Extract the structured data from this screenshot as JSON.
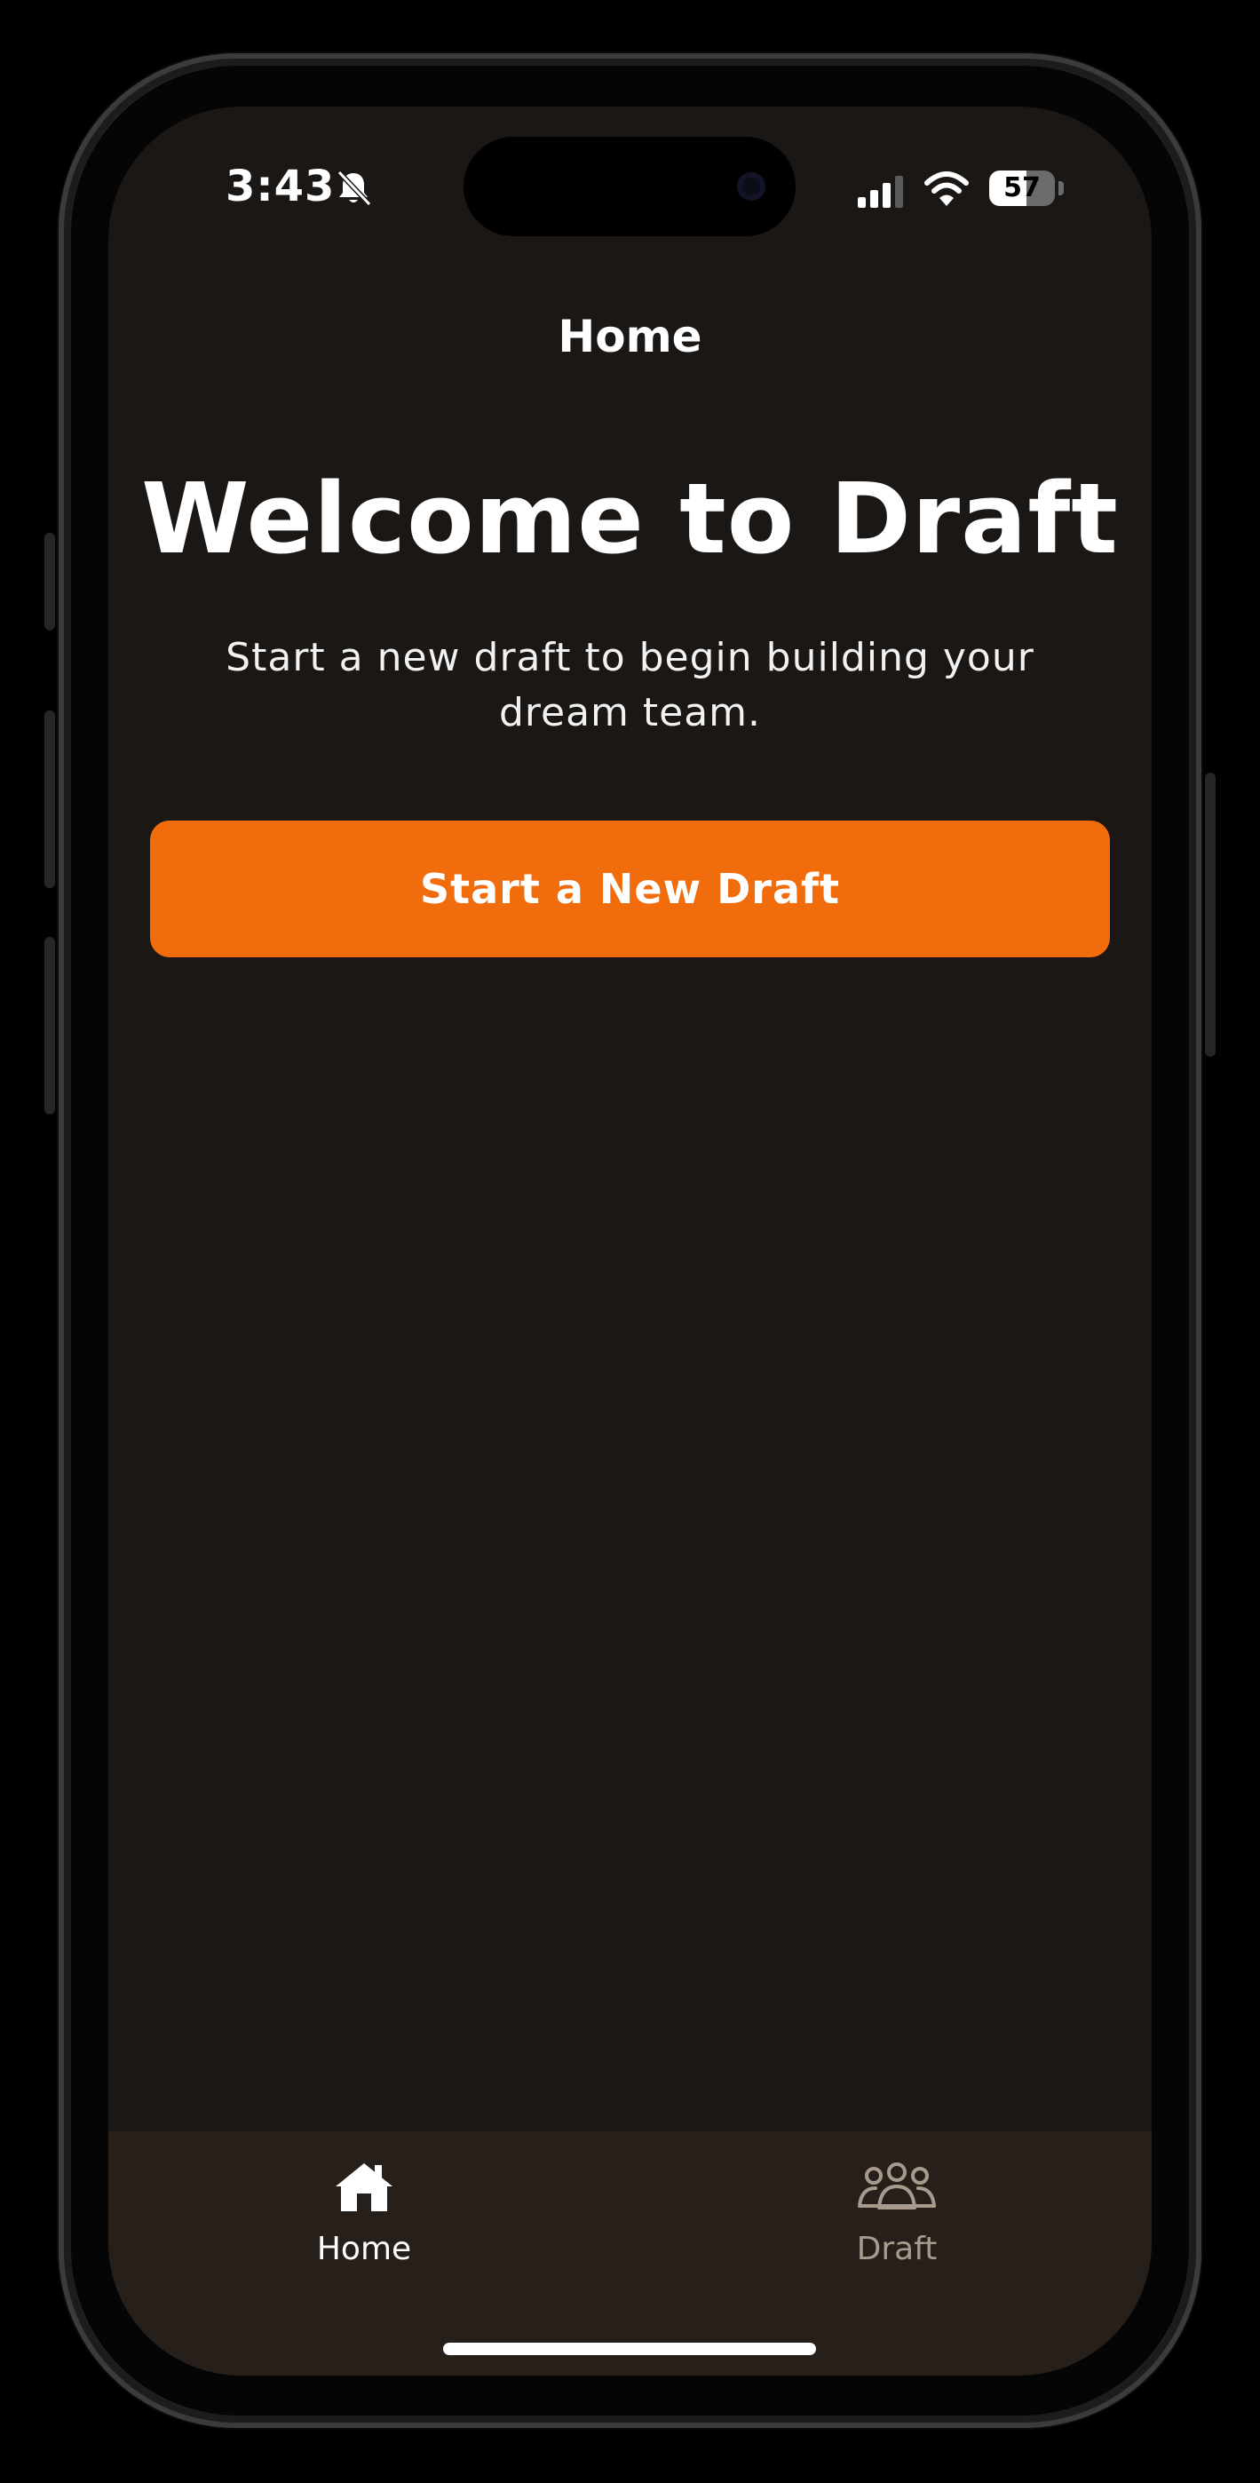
{
  "status_bar": {
    "time": "3:43",
    "battery_level": "57",
    "icons": [
      "bell-slash-icon",
      "cellular-signal-icon",
      "wifi-icon",
      "battery-icon"
    ]
  },
  "header": {
    "title": "Home"
  },
  "main": {
    "heading": "Welcome to Draft",
    "subheading": "Start a new draft to begin building your dream team.",
    "primary_button_label": "Start a New Draft"
  },
  "tab_bar": {
    "tabs": [
      {
        "label": "Home",
        "icon": "house-icon",
        "active": true
      },
      {
        "label": "Draft",
        "icon": "people-group-icon",
        "active": false
      }
    ]
  },
  "colors": {
    "accent": "#f16c0c",
    "background": "#1a1714",
    "tab_bar_background": "#261f1a",
    "inactive_tab": "#a89a8c"
  }
}
